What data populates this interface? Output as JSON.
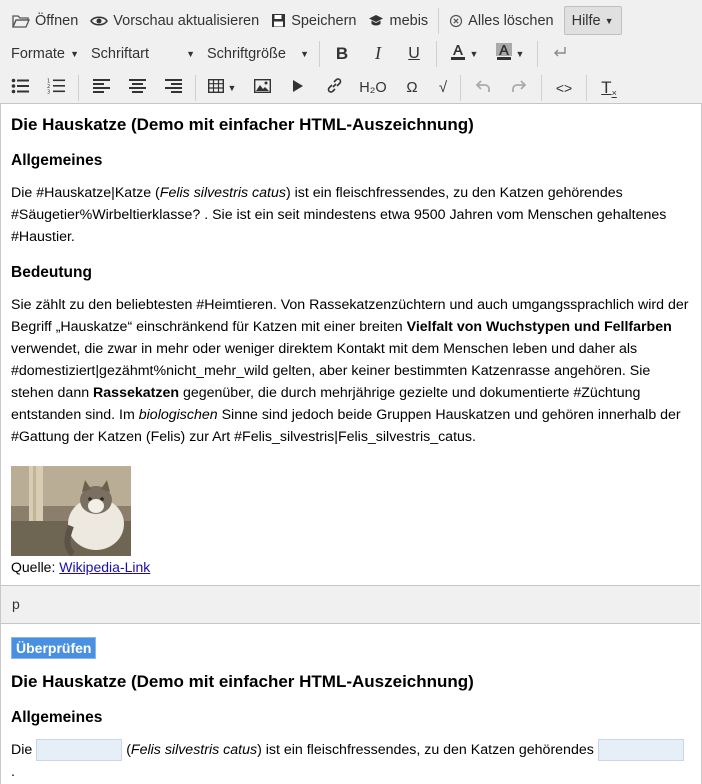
{
  "toolbar": {
    "open": "Öffnen",
    "preview": "Vorschau aktualisieren",
    "save": "Speichern",
    "mebis": "mebis",
    "clear": "Alles löschen",
    "help": "Hilfe",
    "formats": "Formate",
    "font": "Schriftart",
    "fontsize": "Schriftgröße",
    "bold": "B",
    "italic": "I",
    "underline": "U",
    "h2o": "H₂O",
    "omega": "Ω",
    "sqrt": "√",
    "code": "<>",
    "clearformat": "T"
  },
  "icons": {
    "open": "folder-open-icon",
    "preview": "eye-icon",
    "save": "floppy-disk-icon",
    "mebis": "graduation-cap-icon",
    "clear": "clear-circle-icon",
    "enter": "return-arrow-icon"
  },
  "editor": {
    "title": "Die Hauskatze (Demo mit einfacher HTML-Auszeichnung)",
    "sec1": "Allgemeines",
    "p1a": "Die #Hauskatze|Katze (",
    "p1latin": "Felis silvestris catus",
    "p1b": ") ist ein fleischfressendes, zu den Katzen gehörendes #Säugetier%Wirbeltierklasse? . Sie ist ein seit mindestens etwa 9500 Jahren vom Menschen gehaltenes #Haustier.",
    "sec2": "Bedeutung",
    "p2a": "Sie zählt zu den beliebtesten #Heimtieren. Von Rassekatzenzüchtern und auch umgangssprachlich wird der Begriff „Hauskatze“ einschränkend für Katzen mit einer breiten ",
    "p2bold": "Vielfalt von Wuchstypen und Fellfarben",
    "p2b": " verwendet, die zwar in mehr oder weniger direktem Kontakt mit dem Menschen leben und daher als #domestiziert|gezähmt%nicht_mehr_wild gelten, aber keiner bestimmten Katzenrasse angehören. Sie stehen dann ",
    "p2bold2": "Rassekatzen",
    "p2c": " gegenüber, die durch mehrjährige gezielte und dokumentierte #Züchtung entstanden sind. Im ",
    "p2ital": "biologischen",
    "p2d": " Sinne sind jedoch beide Gruppen Hauskatzen und gehören innerhalb der #Gattung der Katzen (Felis) zur Art #Felis_silvestris|Felis_silvestris_catus.",
    "source_label": "Quelle: ",
    "source_link": "Wikipedia-Link"
  },
  "status": {
    "path": "p"
  },
  "preview": {
    "check_button": "Überprüfen",
    "title": "Die Hauskatze (Demo mit einfacher HTML-Auszeichnung)",
    "sec1": "Allgemeines",
    "p1a": "Die",
    "p1latin": "Felis silvestris catus",
    "p1b": ") ist ein fleischfressendes, zu den Katzen gehörendes",
    "p1c": "."
  }
}
